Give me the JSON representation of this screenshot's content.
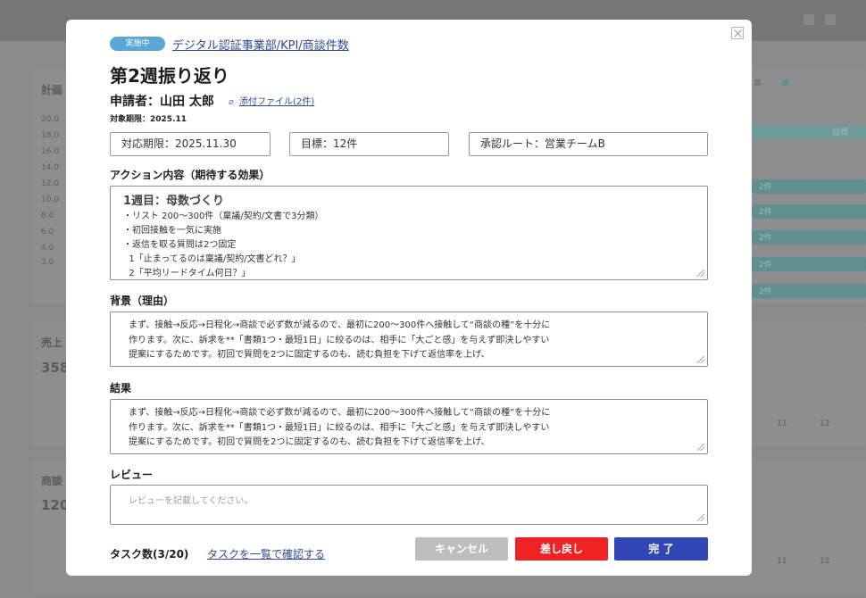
{
  "background": {
    "labels": {
      "section1": "計画",
      "section2": "売上",
      "section3": "商談",
      "value1": "358",
      "value2": "120",
      "y_ticks": [
        "20.0",
        "18.0",
        "16.0",
        "14.0",
        "12.0",
        "10.0",
        "8.0",
        "6.0",
        "4.0",
        "3.0"
      ],
      "bars": [
        "目標",
        "2件",
        "2件",
        "2件",
        "2件",
        "2件"
      ],
      "x_ticks": [
        "11",
        "12"
      ]
    }
  },
  "modal": {
    "status_badge": "実施中",
    "breadcrumb": "デジタル認証事業部/KPI/商談件数",
    "title": "第2週振り返り",
    "applicant": "申請者：山田 太郎",
    "attachment_link": "添付ファイル(2件)",
    "target_period_small": "対象期限：2025.11",
    "info": {
      "deadline": "対応期限：2025.11.30",
      "goal": "目標：12件",
      "approval_route": "承認ルート：営業チームB"
    },
    "action": {
      "label": "アクション内容（期待する効果）",
      "heading": "1週目：母数づくり",
      "lines": [
        "・リスト 200〜300件（稟議/契約/文書で3分類）",
        "・初回接触を一気に実施",
        "・返信を取る質問は2つ固定",
        "  1「止まってるのは稟議/契約/文書どれ？」",
        "  2「平均リードタイム何日？」"
      ]
    },
    "background_section": {
      "label": "背景（理由）",
      "lines": [
        "まず、接触→反応→日程化→商談で必ず数が減るので、最初に200〜300件へ接触して“商談の種”を十分に",
        "作ります。次に、訴求を**「書類1つ・最短1日」に絞るのは、相手に「大ごと感」を与えず即決しやすい",
        "提案にするためです。初回で質問を2つに固定するのも、読む負担を下げて返信率を上げ、"
      ]
    },
    "result_section": {
      "label": "結果",
      "lines": [
        "まず、接触→反応→日程化→商談で必ず数が減るので、最初に200〜300件へ接触して“商談の種”を十分に",
        "作ります。次に、訴求を**「書類1つ・最短1日」に絞るのは、相手に「大ごと感」を与えず即決しやすい",
        "提案にするためです。初回で質問を2つに固定するのも、読む負担を下げて返信率を上げ、"
      ]
    },
    "review": {
      "label": "レビュー",
      "placeholder": "レビューを記載してください。"
    },
    "footer": {
      "task_count": "タスク数(3/20)",
      "task_link": "タスクを一覧で確認する",
      "cancel_label": "キャンセル",
      "send_back_label": "差し戻し",
      "complete_label": "完 了"
    }
  },
  "colors": {
    "badge": "#5aa7d6",
    "link": "#2e4a8c",
    "cancel": "#bdbdbd",
    "send_back": "#ef2323",
    "complete": "#3147b3"
  }
}
